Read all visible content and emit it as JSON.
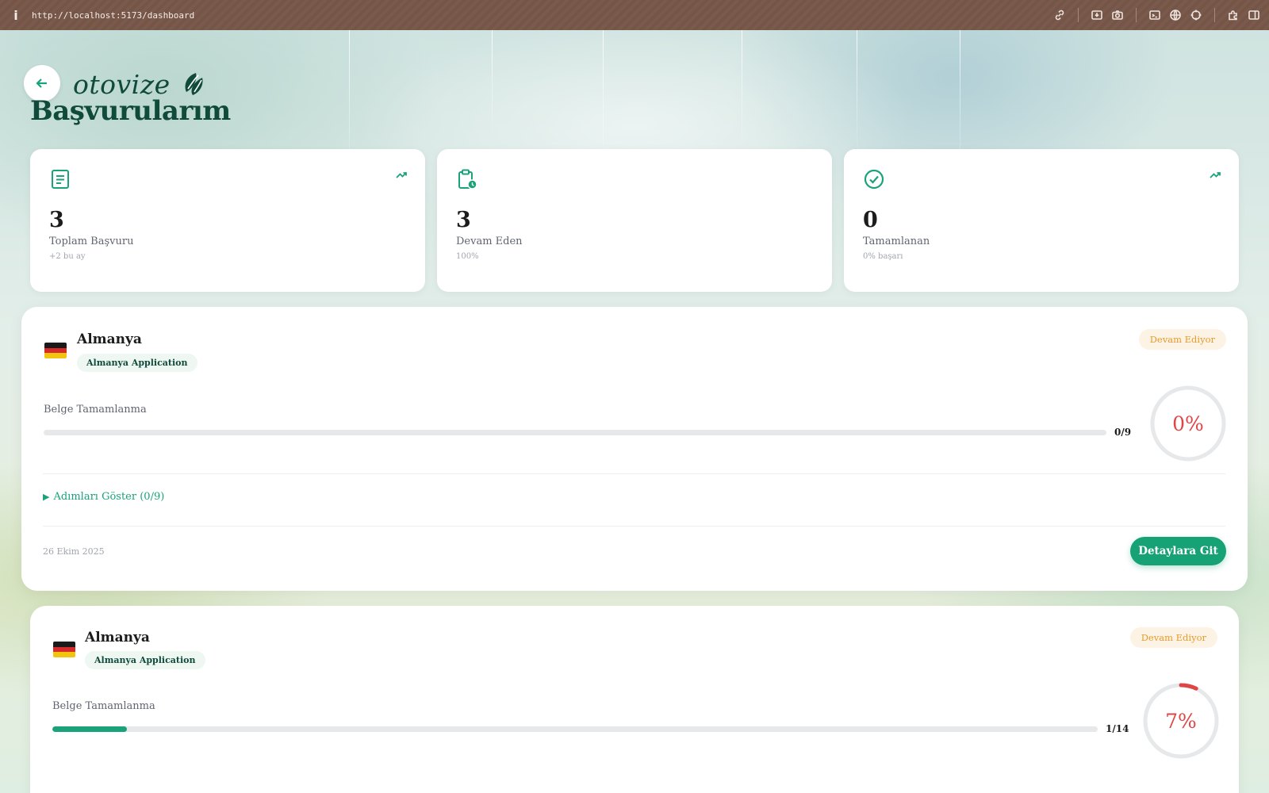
{
  "browser": {
    "info_icon": "i",
    "url": "http://localhost:5173/dashboard",
    "tools": [
      "link-icon",
      "save-page-icon",
      "camera-icon",
      "terminal-icon",
      "globe-icon",
      "crosshair-icon",
      "extension-icon",
      "sidebar-icon"
    ]
  },
  "header": {
    "brand_name": "otovize",
    "title": "Başvurularım"
  },
  "stats": [
    {
      "icon": "document-icon",
      "value": "3",
      "label": "Toplam Başvuru",
      "sub": "+2 bu ay",
      "trend": true
    },
    {
      "icon": "clipboard-clock-icon",
      "value": "3",
      "label": "Devam Eden",
      "sub": "100%",
      "trend": false
    },
    {
      "icon": "check-circle-icon",
      "value": "0",
      "label": "Tamamlanan",
      "sub": "0% başarı",
      "trend": true
    }
  ],
  "applications": [
    {
      "country": "Almanya",
      "type": "Almanya Application",
      "status": "Devam Ediyor",
      "progress_label": "Belge Tamamlanma",
      "completed": 0,
      "total": 9,
      "count_text": "0/9",
      "percent_text": "0%",
      "percent": 0,
      "steps_toggle": "Adımları Göster (0/9)",
      "date": "26 Ekim 2025",
      "detail_button": "Detaylara Git"
    },
    {
      "country": "Almanya",
      "type": "Almanya Application",
      "status": "Devam Ediyor",
      "progress_label": "Belge Tamamlanma",
      "completed": 1,
      "total": 14,
      "count_text": "1/14",
      "percent_text": "7%",
      "percent": 7
    }
  ],
  "colors": {
    "accent": "#1aa37a",
    "brand_dark": "#0f4a3a",
    "status": "#e49b2e",
    "ring_red": "#e04545"
  }
}
